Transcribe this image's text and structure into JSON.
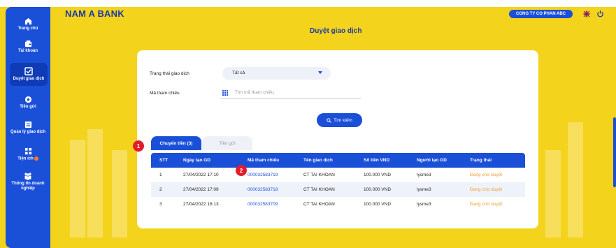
{
  "brand": {
    "logo": "NAM A BANK"
  },
  "header": {
    "company": "CONG TY CO PHAN ABC",
    "page_title": "Duyệt giao dịch"
  },
  "sidebar": {
    "items": [
      {
        "label": "Trang chủ",
        "icon": "home-icon"
      },
      {
        "label": "Tài khoản",
        "icon": "wallet-icon"
      },
      {
        "label": "Duyệt giao dịch",
        "icon": "checkbox-icon",
        "active": true
      },
      {
        "label": "Tiền gửi",
        "icon": "savings-icon"
      },
      {
        "label": "Quản lý giao dịch",
        "icon": "document-icon"
      },
      {
        "label": "Tiện ích",
        "icon": "apps-icon"
      },
      {
        "label": "Thông tin doanh nghiệp",
        "icon": "people-icon"
      }
    ]
  },
  "filters": {
    "status_label": "Trạng thái giao dịch",
    "status_value": "Tất cả",
    "ref_label": "Mã tham chiếu",
    "ref_placeholder": "Tìm mã tham chiếu",
    "search_label": "Tìm kiếm"
  },
  "tabs": [
    {
      "label": "Chuyển tiền (3)",
      "active": true
    },
    {
      "label": "Tiền gửi",
      "active": false
    }
  ],
  "markers": [
    "1",
    "2"
  ],
  "table": {
    "headers": [
      "STT",
      "Ngày tạo GD",
      "Mã tham chiếu",
      "Tên giao dịch",
      "Số tiền VND",
      "Người tạo GD",
      "Trạng thái"
    ],
    "rows": [
      [
        "1",
        "27/04/2022 17:10",
        "000032583719",
        "CT TAI KHOAN",
        "100.000 VND",
        "lysme3",
        "Đang chờ duyệt"
      ],
      [
        "2",
        "27/04/2022 17:09",
        "000032583718",
        "CT TAI KHOAN",
        "100.000 VND",
        "lysme3",
        "Đang chờ duyệt"
      ],
      [
        "3",
        "27/04/2022 16:13",
        "000032583709",
        "CT TAI KHOAN",
        "100.000 VND",
        "lysme3",
        "Đang chờ duyệt"
      ]
    ]
  },
  "colors": {
    "primary": "#1a4fd8",
    "background": "#f4d31c",
    "pending": "#f39c34",
    "marker": "#e21d2b"
  }
}
